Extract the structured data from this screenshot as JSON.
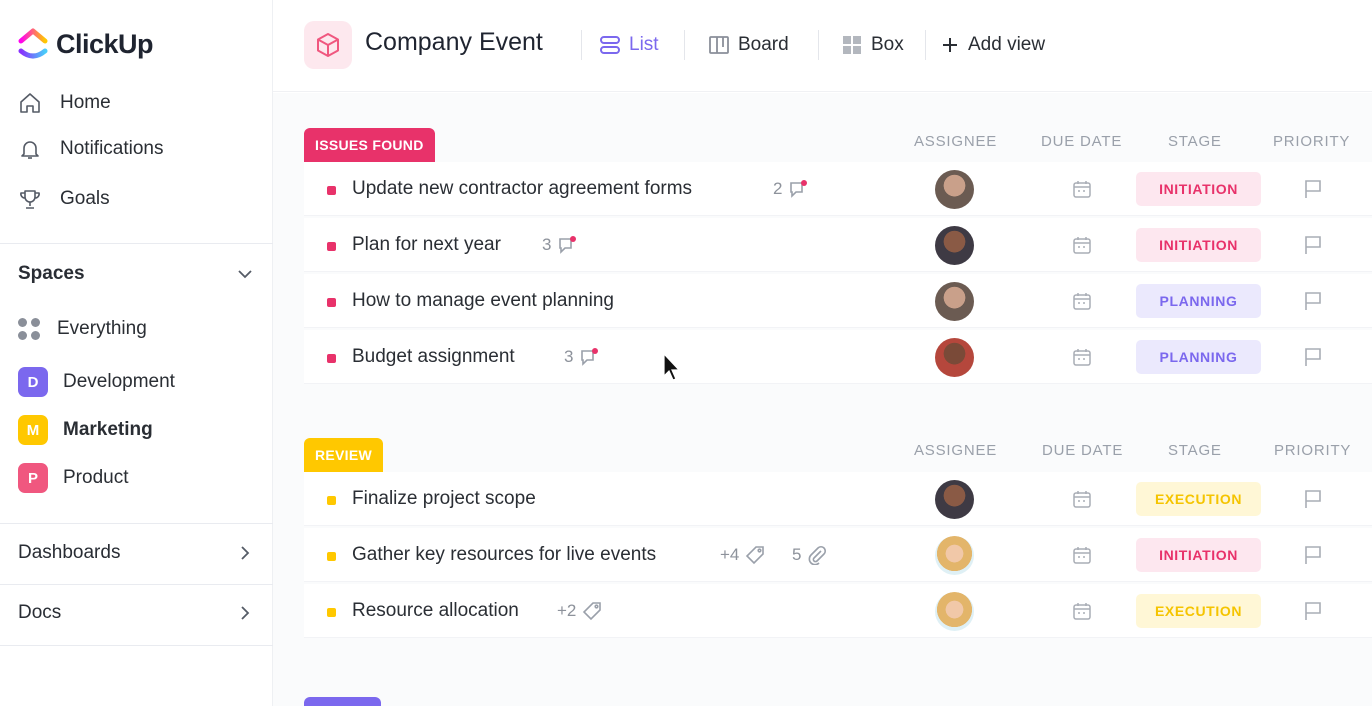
{
  "app": {
    "name": "ClickUp"
  },
  "sidebar": {
    "nav": [
      {
        "label": "Home",
        "icon": "home-icon"
      },
      {
        "label": "Notifications",
        "icon": "bell-icon"
      },
      {
        "label": "Goals",
        "icon": "trophy-icon"
      }
    ],
    "spaces_label": "Spaces",
    "everything_label": "Everything",
    "spaces": [
      {
        "letter": "D",
        "label": "Development",
        "color": "#7b68ee"
      },
      {
        "letter": "M",
        "label": "Marketing",
        "color": "#ffc800"
      },
      {
        "letter": "P",
        "label": "Product",
        "color": "#f0577f"
      }
    ],
    "dashboards_label": "Dashboards",
    "docs_label": "Docs"
  },
  "header": {
    "project_title": "Company Event",
    "views": [
      {
        "label": "List",
        "icon": "list-icon",
        "active": true
      },
      {
        "label": "Board",
        "icon": "board-icon",
        "active": false
      },
      {
        "label": "Box",
        "icon": "box-icon",
        "active": false
      }
    ],
    "add_view_label": "Add view"
  },
  "columns": {
    "assignee": "ASSIGNEE",
    "due_date": "DUE DATE",
    "stage": "STAGE",
    "priority": "PRIORITY"
  },
  "groups": [
    {
      "tag": "ISSUES FOUND",
      "color": "#e8326a",
      "tasks": [
        {
          "name": "Update new contractor agreement forms",
          "meta": "2",
          "stage": "INITIATION"
        },
        {
          "name": "Plan for next year",
          "meta": "3",
          "stage": "INITIATION"
        },
        {
          "name": "How to manage event planning",
          "meta": "",
          "stage": "PLANNING"
        },
        {
          "name": "Budget assignment",
          "meta": "3",
          "stage": "PLANNING"
        }
      ]
    },
    {
      "tag": "REVIEW",
      "color": "#ffc800",
      "tasks": [
        {
          "name": "Finalize project scope",
          "meta": "",
          "stage": "EXECUTION"
        },
        {
          "name": "Gather key resources for live events",
          "meta_tag": "+4",
          "meta_attach": "5",
          "stage": "INITIATION"
        },
        {
          "name": "Resource allocation",
          "meta_tag": "+2",
          "stage": "EXECUTION"
        }
      ]
    }
  ],
  "stage_colors": {
    "INITIATION": {
      "bg": "#fde7ef",
      "fg": "#e8326a"
    },
    "PLANNING": {
      "bg": "#ebe9fd",
      "fg": "#7b68ee"
    },
    "EXECUTION": {
      "bg": "#fff7d6",
      "fg": "#f5c400"
    }
  }
}
